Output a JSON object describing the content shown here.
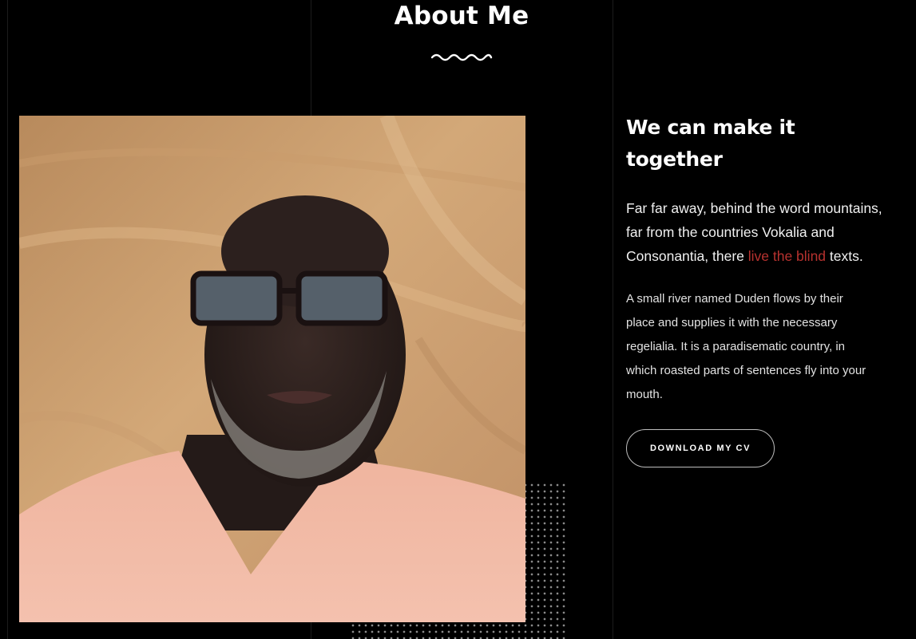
{
  "about": {
    "title": "About Me"
  },
  "photo": {
    "name": "profile-photo"
  },
  "intro": {
    "heading": "We can make it together",
    "lead_before": "Far far away, behind the word mountains, far from the countries Vokalia and Consonantia, there ",
    "lead_highlight": "live the blind",
    "lead_after": " texts.",
    "paragraph": "A small river named Duden flows by their place and supplies it with the necessary regelialia. It is a paradisematic country, in which roasted parts of sentences fly into your mouth.",
    "cv_button": "DOWNLOAD MY CV"
  },
  "colors": {
    "background": "#000000",
    "accent": "#b8322f",
    "text": "#ffffff",
    "button_border": "#bdbdbd"
  }
}
